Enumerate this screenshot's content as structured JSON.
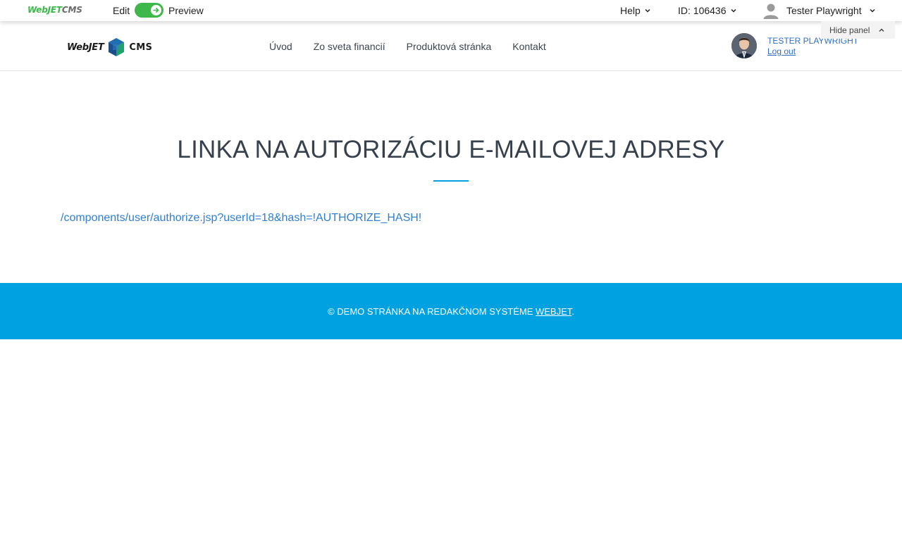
{
  "adminbar": {
    "logo_web": "WebJET",
    "logo_cms": "CMS",
    "edit_label": "Edit",
    "preview_label": "Preview",
    "help_label": "Help",
    "page_id": "ID: 106436",
    "user_name": "Tester Playwright",
    "hide_panel": "Hide panel",
    "toggle_color": "#3eb84b"
  },
  "site": {
    "logo_web": "WebJET",
    "logo_cms": "CMS",
    "nav": [
      "Úvod",
      "Zo sveta financií",
      "Produktová stránka",
      "Kontakt"
    ],
    "profile_name": "TESTER PLAYWRIGHT",
    "logout": "Log out"
  },
  "main": {
    "title": "LINKA NA AUTORIZÁCIU E-MAILOVEJ ADRESY",
    "auth_link": "/components/user/authorize.jsp?userId=18&hash=!AUTHORIZE_HASH!",
    "accent_color": "#00a0e0"
  },
  "footer": {
    "text": "© DEMO STRÁNKA NA REDAKČNOM SYSTÉME ",
    "link": "WEBJET",
    "suffix": ".",
    "bg_color": "#00a1e0"
  }
}
